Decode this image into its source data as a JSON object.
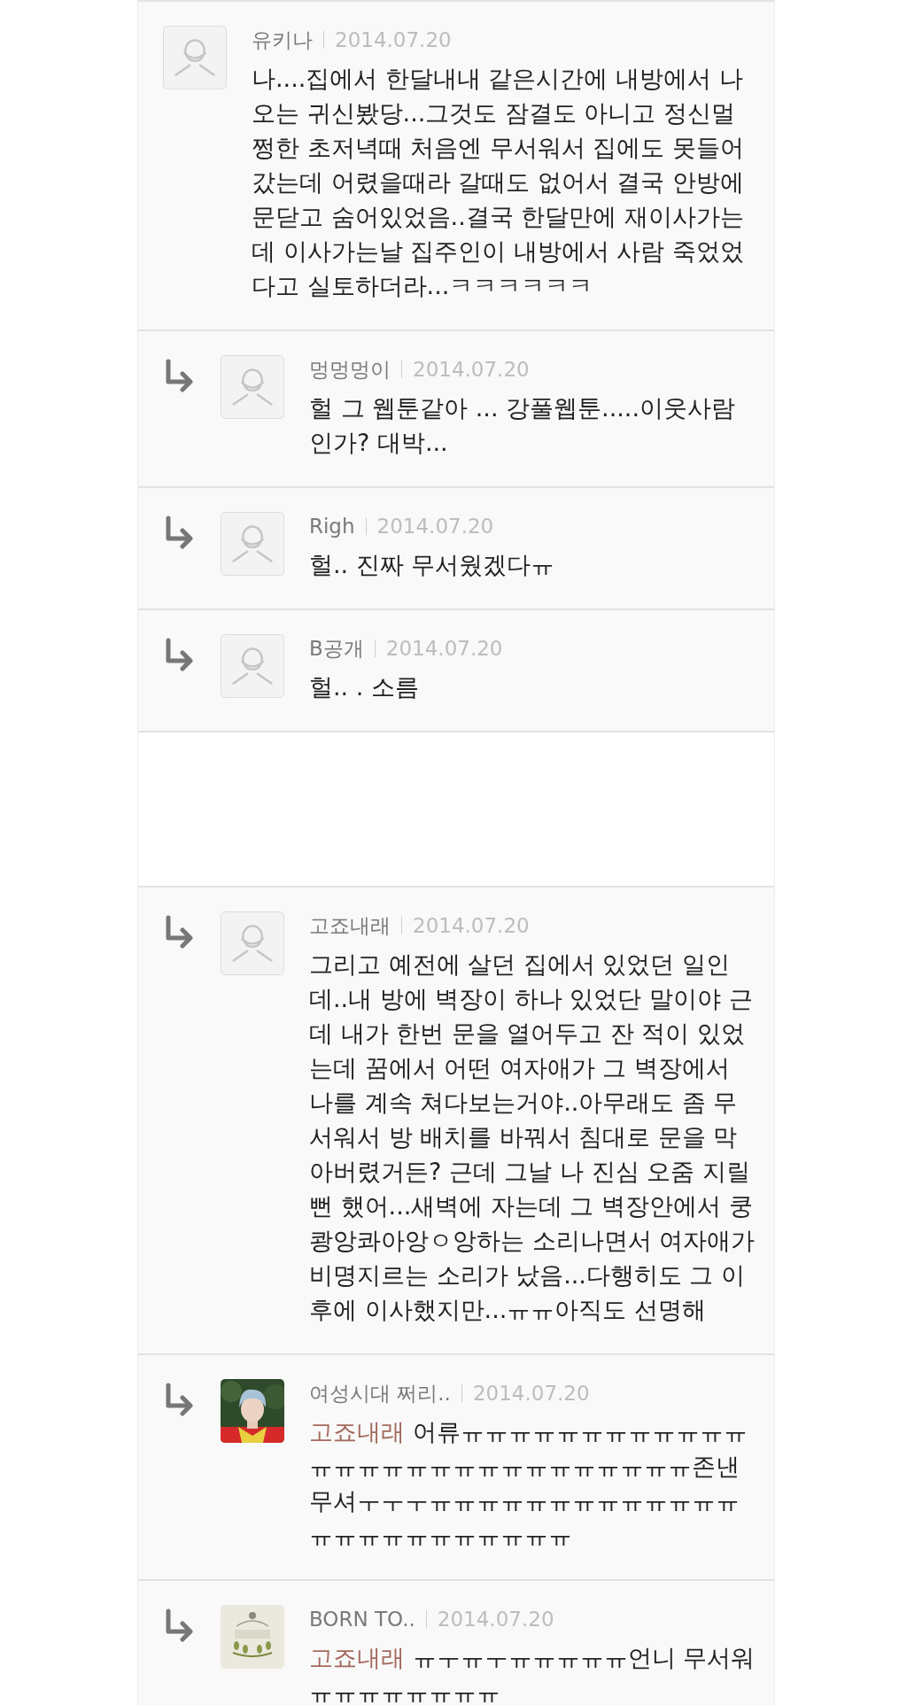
{
  "comments": [
    {
      "kind": "comment",
      "avatar": {
        "kind": "default"
      },
      "author": "유키나",
      "date": "2014.07.20",
      "text": "나....집에서 한달내내 같은시간에 내방에서 나오는 귀신봤당...그것도 잠결도 아니고 정신멀쩡한 초저녁때 처음엔 무서워서 집에도 못들어갔는데 어렸을때라 갈때도 없어서 결국 안방에 문닫고 숨어있었음..결국 한달만에 재이사가는데 이사가는날  집주인이 내방에서 사람 죽었었다고 실토하더라...ㅋㅋㅋㅋㅋㅋ"
    },
    {
      "kind": "reply",
      "avatar": {
        "kind": "default"
      },
      "author": "멍멍멍이",
      "date": "2014.07.20",
      "text": "헐 그 웹툰같아 ... 강풀웹툰.....이웃사람인가? 대박..."
    },
    {
      "kind": "reply",
      "avatar": {
        "kind": "default"
      },
      "author": "Righ",
      "date": "2014.07.20",
      "text": "헐.. 진짜 무서웠겠다ㅠ"
    },
    {
      "kind": "reply",
      "avatar": {
        "kind": "default"
      },
      "author": "B공개",
      "date": "2014.07.20",
      "text": "헐.. . 소름"
    },
    {
      "kind": "blank"
    },
    {
      "kind": "reply",
      "avatar": {
        "kind": "default"
      },
      "author": "고죠내래",
      "date": "2014.07.20",
      "text": "그리고 예전에 살던 집에서 있었던 일인데..내 방에 벽장이 하나 있었단 말이야 근데 내가 한번 문을 열어두고 잔 적이 있었는데 꿈에서 어떤 여자애가 그 벽장에서 나를 계속 쳐다보는거야..아무래도 좀 무서워서 방 배치를 바꿔서 침대로 문을 막아버렸거든? 근데 그날 나 진심 오줌 지릴뻔 했어...새벽에 자는데 그 벽장안에서 쿵쾅앙콰아앙ㅇ앙하는 소리나면서 여자애가 비명지르는 소리가 났음...다행히도 그 이후에 이사했지만...ㅠㅠ아직도 선명해"
    },
    {
      "kind": "reply",
      "author": "여성시대 쩌리..",
      "date": "2014.07.20",
      "mention": "고죠내래",
      "text": "어류ㅠㅠㅠㅠㅠㅠㅠㅠㅠㅠㅠㅠㅠㅠㅠㅠㅠㅠㅠㅠㅠㅠㅠㅠㅠㅠㅠㅠ존낸무셔ㅜㅜㅜㅠㅠㅠㅠㅠㅠㅠㅠㅠㅠㅠㅠㅠㅠㅠㅠㅠㅠㅠㅠㅠㅠㅠㅠ"
    },
    {
      "kind": "reply",
      "avatar": {
        "kind": "emblem"
      },
      "author": "BORN TO..",
      "date": "2014.07.20",
      "mention": "고죠내래",
      "text": "ㅠㅜㅠㅜㅠㅠㅠㅠㅠ언니 무서워ㅠㅠㅠㅠㅠㅠㅠㅠ"
    }
  ]
}
